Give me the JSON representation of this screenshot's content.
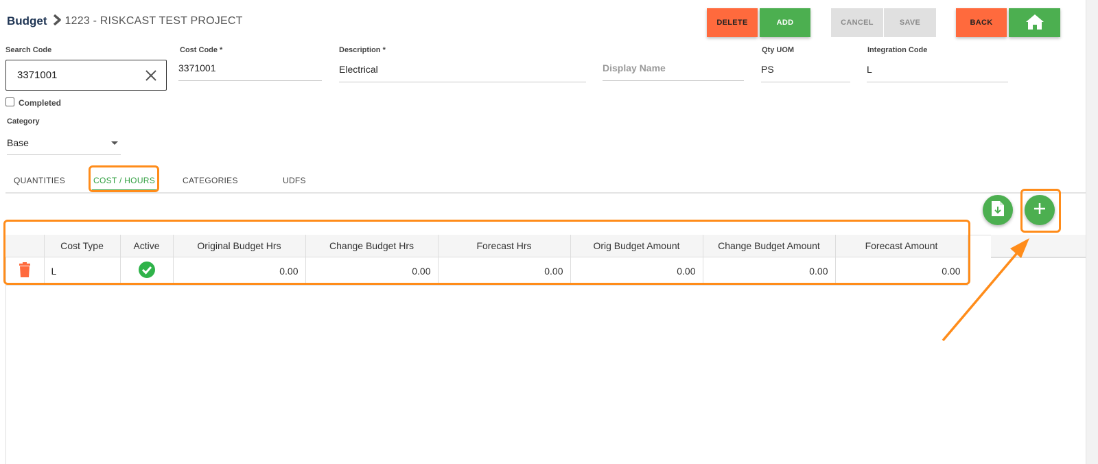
{
  "breadcrumb": {
    "root": "Budget",
    "project": "1223 - RISKCAST TEST PROJECT"
  },
  "toolbar": {
    "delete_label": "DELETE",
    "add_label": "ADD",
    "cancel_label": "CANCEL",
    "save_label": "SAVE",
    "back_label": "BACK",
    "home_icon": "home-icon"
  },
  "form": {
    "search_code": {
      "label": "Search Code",
      "value": "3371001"
    },
    "cost_code": {
      "label": "Cost Code *",
      "value": "3371001"
    },
    "description": {
      "label": "Description *",
      "value": "Electrical"
    },
    "display_name": {
      "placeholder": "Display Name"
    },
    "qty_uom": {
      "label": "Qty UOM",
      "value": "PS"
    },
    "integration_code": {
      "label": "Integration Code",
      "value": "L"
    },
    "completed_label": "Completed",
    "category": {
      "label": "Category",
      "value": "Base"
    }
  },
  "tabs": [
    {
      "label": "QUANTITIES"
    },
    {
      "label": "COST / HOURS"
    },
    {
      "label": "CATEGORIES"
    },
    {
      "label": "UDFS"
    }
  ],
  "grid": {
    "columns": [
      "Cost Type",
      "Active",
      "Original Budget Hrs",
      "Change Budget Hrs",
      "Forecast Hrs",
      "Orig Budget Amount",
      "Change Budget Amount",
      "Forecast Amount"
    ],
    "rows": [
      {
        "cost_type": "L",
        "active": true,
        "original_budget_hrs": "0.00",
        "change_budget_hrs": "0.00",
        "forecast_hrs": "0.00",
        "orig_budget_amount": "0.00",
        "change_budget_amount": "0.00",
        "forecast_amount": "0.00"
      }
    ]
  },
  "colors": {
    "accent_green": "#4caf50",
    "danger_orange": "#ff6a3d",
    "annotation_orange": "#ff8c1a",
    "tab_active": "#2e9e3e"
  }
}
